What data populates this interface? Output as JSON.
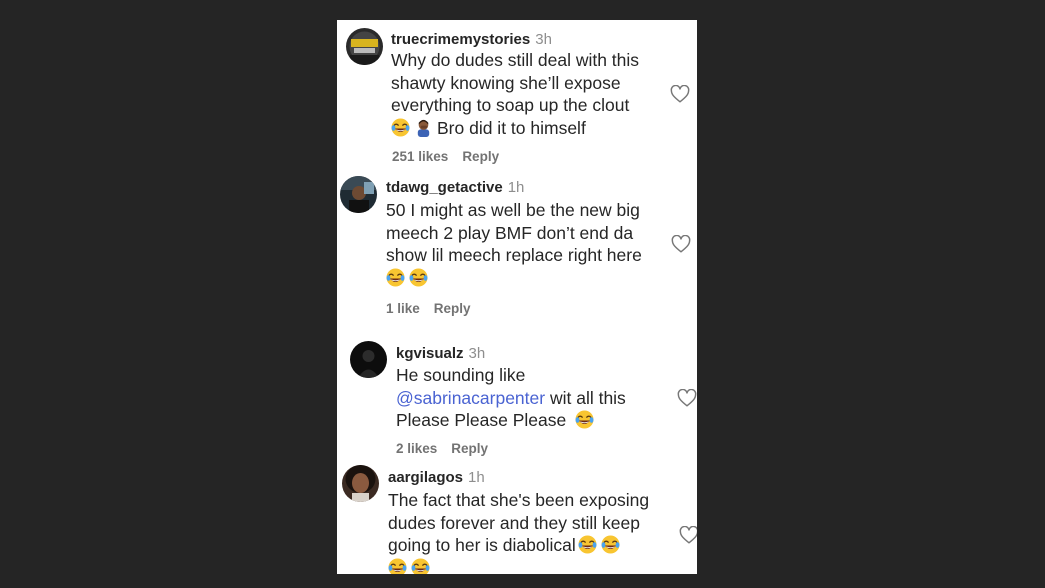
{
  "comments": [
    {
      "username": "truecrimemystories",
      "time": "3h",
      "line1": "Why do dudes still deal with this",
      "line2": "shawty knowing she’ll expose",
      "line3": "everything to soap up the clout",
      "line4": "Bro did it to himself",
      "likes": "251 likes",
      "reply": "Reply"
    },
    {
      "username": "tdawg_getactive",
      "time": "1h",
      "line1": "50 I might as well be the new big",
      "line2": "meech 2 play BMF don’t end da",
      "line3": "show lil meech replace right here",
      "likes": "1 like",
      "reply": "Reply"
    },
    {
      "username": "kgvisualz",
      "time": "3h",
      "line1": "He sounding like",
      "mention": "@sabrinacarpenter",
      "line2_rest": " wit all this",
      "line3": "Please Please Please",
      "likes": "2 likes",
      "reply": "Reply"
    },
    {
      "username": "aargilagos",
      "time": "1h",
      "line1": "The fact that she's been exposing",
      "line2": "dudes forever and they still keep",
      "line3": "going to her is diabolical"
    }
  ],
  "icons": {
    "like": "heart-outline-icon",
    "laugh": "face-with-tears-of-joy-emoji",
    "shrug": "person-facepalming-emoji"
  },
  "colors": {
    "background": "#252525",
    "panel": "#ffffff",
    "text": "#262626",
    "muted": "#8e8e8e",
    "mention": "#4a63d2"
  }
}
